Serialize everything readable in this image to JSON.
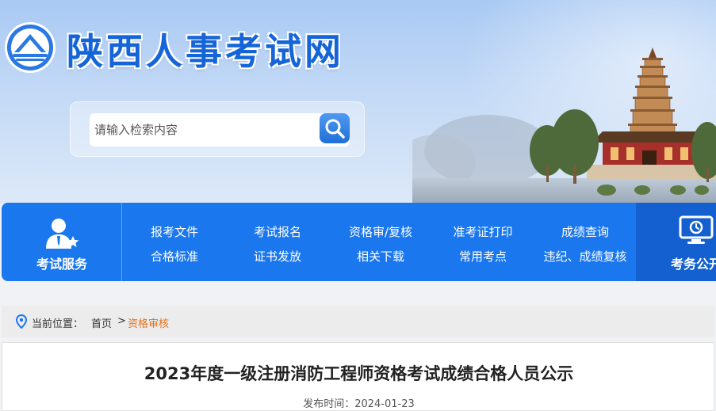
{
  "site": {
    "title": "陕西人事考试网"
  },
  "search": {
    "placeholder": "请输入检索内容"
  },
  "nav": {
    "left_label": "考试服务",
    "links_row1": [
      "报考文件",
      "考试报名",
      "资格审/复核",
      "准考证打印",
      "成绩查询"
    ],
    "links_row2": [
      "合格标准",
      "证书发放",
      "相关下载",
      "常用考点",
      "违纪、成绩复核"
    ],
    "right_label": "考务公开"
  },
  "breadcrumb": {
    "prefix": "当前位置：",
    "home": "首页",
    "separator": ">",
    "current": "资格审核"
  },
  "article": {
    "title": "2023年度一级注册消防工程师资格考试成绩合格人员公示",
    "publish_label": "发布时间：",
    "publish_date": "2024-01-23"
  },
  "colors": {
    "brand_blue": "#1a77ee",
    "title_blue": "#1565d8",
    "breadcrumb_accent": "#e8711a"
  },
  "icons": [
    "emblem-icon",
    "search-icon",
    "user-service-icon",
    "monitor-clock-icon",
    "location-pin-icon"
  ]
}
